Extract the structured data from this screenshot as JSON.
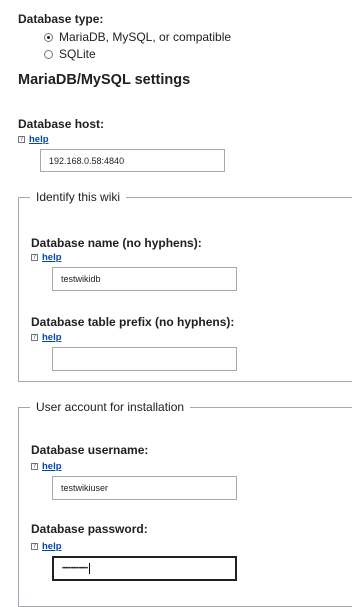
{
  "db_type": {
    "label": "Database type:",
    "options": [
      {
        "label": "MariaDB, MySQL, or compatible",
        "selected": true
      },
      {
        "label": "SQLite",
        "selected": false
      }
    ]
  },
  "settings_title": "MariaDB/MySQL settings",
  "help_label": "help",
  "help_icon": "?",
  "host": {
    "label": "Database host:",
    "value": "192.168.0.58:4840"
  },
  "wiki_section": {
    "legend": "Identify this wiki",
    "db_name": {
      "label": "Database name (no hyphens):",
      "value": "testwikidb"
    },
    "table_prefix": {
      "label": "Database table prefix (no hyphens):",
      "value": ""
    }
  },
  "user_section": {
    "legend": "User account for installation",
    "username": {
      "label": "Database username:",
      "value": "testwikiuser"
    },
    "password": {
      "label": "Database password:",
      "value": "••••••••••••••••"
    }
  }
}
